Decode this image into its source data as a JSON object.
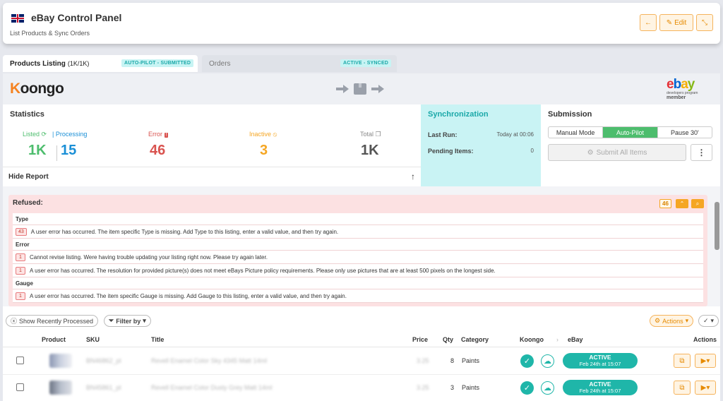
{
  "header": {
    "title": "eBay Control Panel",
    "subtitle": "List Products & Sync Orders",
    "edit_label": "Edit"
  },
  "tabs": [
    {
      "label": "Products Listing",
      "count": "(1K/1K)",
      "badge": "AUTO-PILOT - SUBMITTED"
    },
    {
      "label": "Orders",
      "badge": "ACTIVE - SYNCED"
    }
  ],
  "logo": {
    "koongo_rest": "oongo",
    "koongo_k": "K"
  },
  "ebay_logo": {
    "e": "e",
    "b": "b",
    "a": "a",
    "y": "y",
    "line1": "developers program",
    "line2": "member"
  },
  "statistics": {
    "title": "Statistics",
    "listed_label": "Listed",
    "processing_label": "Processing",
    "listed_value": "1K",
    "processing_value": "15",
    "error_label": "Error",
    "error_value": "46",
    "inactive_label": "Inactive",
    "inactive_value": "3",
    "total_label": "Total",
    "total_value": "1K",
    "hide_report": "Hide Report"
  },
  "synchronization": {
    "title": "Synchronization",
    "last_run_label": "Last Run:",
    "last_run_value": "Today at 00:06",
    "pending_label": "Pending Items:",
    "pending_value": "0"
  },
  "submission": {
    "title": "Submission",
    "modes": [
      "Manual Mode",
      "Auto-Pilot",
      "Pause 30'"
    ],
    "active_mode": "Auto-Pilot",
    "submit_all": "Submit All Items"
  },
  "refused": {
    "title": "Refused:",
    "count": "46",
    "groups": [
      {
        "name": "Type",
        "items": [
          {
            "count": "43",
            "text": "A user error has occurred. The item specific Type is missing. Add Type to this listing, enter a valid value, and then try again."
          }
        ]
      },
      {
        "name": "Error",
        "items": [
          {
            "count": "1",
            "text": "Cannot revise listing. Were having trouble updating your listing right now. Please try again later."
          },
          {
            "count": "1",
            "text": "A user error has occurred. The resolution for provided picture(s) does not meet eBays Picture policy requirements. Please only use pictures that are at least 500 pixels on the longest side."
          }
        ]
      },
      {
        "name": "Gauge",
        "items": [
          {
            "count": "1",
            "text": "A user error has occurred. The item specific Gauge is missing. Add Gauge to this listing, enter a valid value, and then try again."
          }
        ]
      }
    ]
  },
  "toolbar": {
    "show_recent": "Show Recently Processed",
    "filter_by": "Filter by",
    "actions": "Actions"
  },
  "table": {
    "headers": {
      "product": "Product",
      "sku": "SKU",
      "title": "Title",
      "price": "Price",
      "qty": "Qty",
      "category": "Category",
      "koongo": "Koongo",
      "ebay": "eBay",
      "actions": "Actions"
    },
    "rows": [
      {
        "sku": "BN46862_pl",
        "title": "Revell Enamel Color Sky 4345 Matt 14ml",
        "price": "3.25",
        "qty": "8",
        "category": "Paints",
        "status": "ACTIVE",
        "status_date": "Feb 24th at 15:07"
      },
      {
        "sku": "BN45861_pl",
        "title": "Revell Enamel Color Dusty Grey Matt 14ml",
        "price": "3.25",
        "qty": "3",
        "category": "Paints",
        "status": "ACTIVE",
        "status_date": "Feb 24th at 15:07"
      }
    ]
  },
  "colors": {
    "accent": "#f5a623",
    "teal": "#1fb6a9",
    "green": "#4dbd6d",
    "error": "#d9534f",
    "processing": "#1a8fd6"
  }
}
